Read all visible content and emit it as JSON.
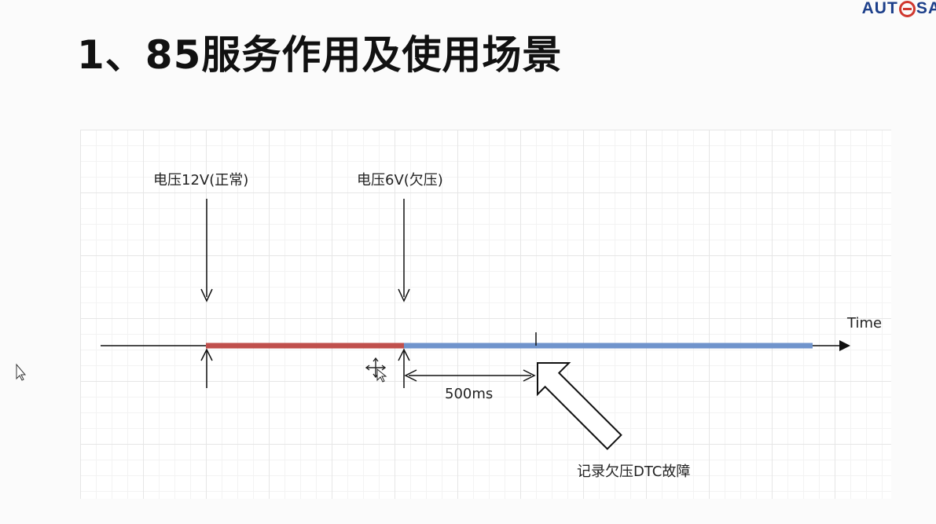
{
  "slide": {
    "title": "1、85服务作用及使用场景",
    "logo_text_left": "AUT",
    "logo_text_right": "SA"
  },
  "diagram": {
    "labels": {
      "voltage_normal": "电压12V(正常)",
      "voltage_under": "电压6V(欠压)",
      "axis_label": "Time",
      "duration": "500ms",
      "dtc_record": "记录欠压DTC故障"
    },
    "colors": {
      "normal_segment": "#c0504d",
      "under_segment": "#7094cc",
      "axis": "#111111"
    },
    "icons": [
      "arrow-down-icon",
      "arrow-up-icon",
      "hollow-arrow-icon",
      "move-cursor-icon",
      "pointer-cursor-icon"
    ]
  }
}
